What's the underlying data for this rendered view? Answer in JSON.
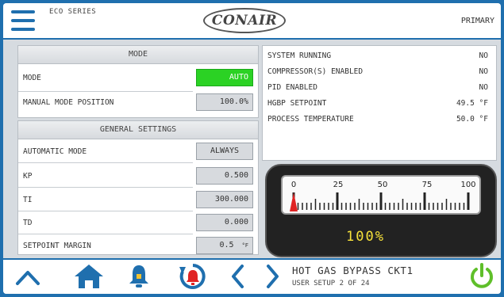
{
  "header": {
    "series": "ECO SERIES",
    "logo": "CONAIR",
    "role": "PRIMARY"
  },
  "mode_panel": {
    "title": "MODE",
    "rows": [
      {
        "label": "MODE",
        "value": "AUTO"
      },
      {
        "label": "MANUAL MODE POSITION",
        "value": "100.0%"
      }
    ]
  },
  "general_panel": {
    "title": "GENERAL SETTINGS",
    "rows": [
      {
        "label": "AUTOMATIC MODE",
        "value": "ALWAYS"
      },
      {
        "label": "KP",
        "value": "0.500"
      },
      {
        "label": "TI",
        "value": "300.000"
      },
      {
        "label": "TD",
        "value": "0.000"
      },
      {
        "label": "SETPOINT MARGIN",
        "value": "0.5",
        "unit": "°F"
      }
    ]
  },
  "status_panel": {
    "rows": [
      {
        "label": "SYSTEM RUNNING",
        "value": "NO"
      },
      {
        "label": "COMPRESSOR(S) ENABLED",
        "value": "NO"
      },
      {
        "label": "PID ENABLED",
        "value": "NO"
      },
      {
        "label": "HGBP SETPOINT",
        "value": "49.5 °F"
      },
      {
        "label": "PROCESS TEMPERATURE",
        "value": "50.0 °F"
      }
    ]
  },
  "gauge": {
    "ticks": [
      "0",
      "25",
      "50",
      "75",
      "100"
    ],
    "readout": "100%",
    "level_percent": 0
  },
  "footer": {
    "title": "HOT GAS BYPASS CKT1",
    "subtitle": "USER SETUP 2 OF 24"
  },
  "colors": {
    "brand_blue": "#1f6fae",
    "auto_green": "#2bd224",
    "power_green": "#5fbf2a",
    "alarm_red": "#e02424",
    "readout_yellow": "#f7e23a"
  },
  "icons": [
    "menu-icon",
    "up-arrow-icon",
    "home-icon",
    "bell-icon",
    "alarm-reset-icon",
    "left-chevron-icon",
    "right-chevron-icon",
    "power-icon"
  ]
}
